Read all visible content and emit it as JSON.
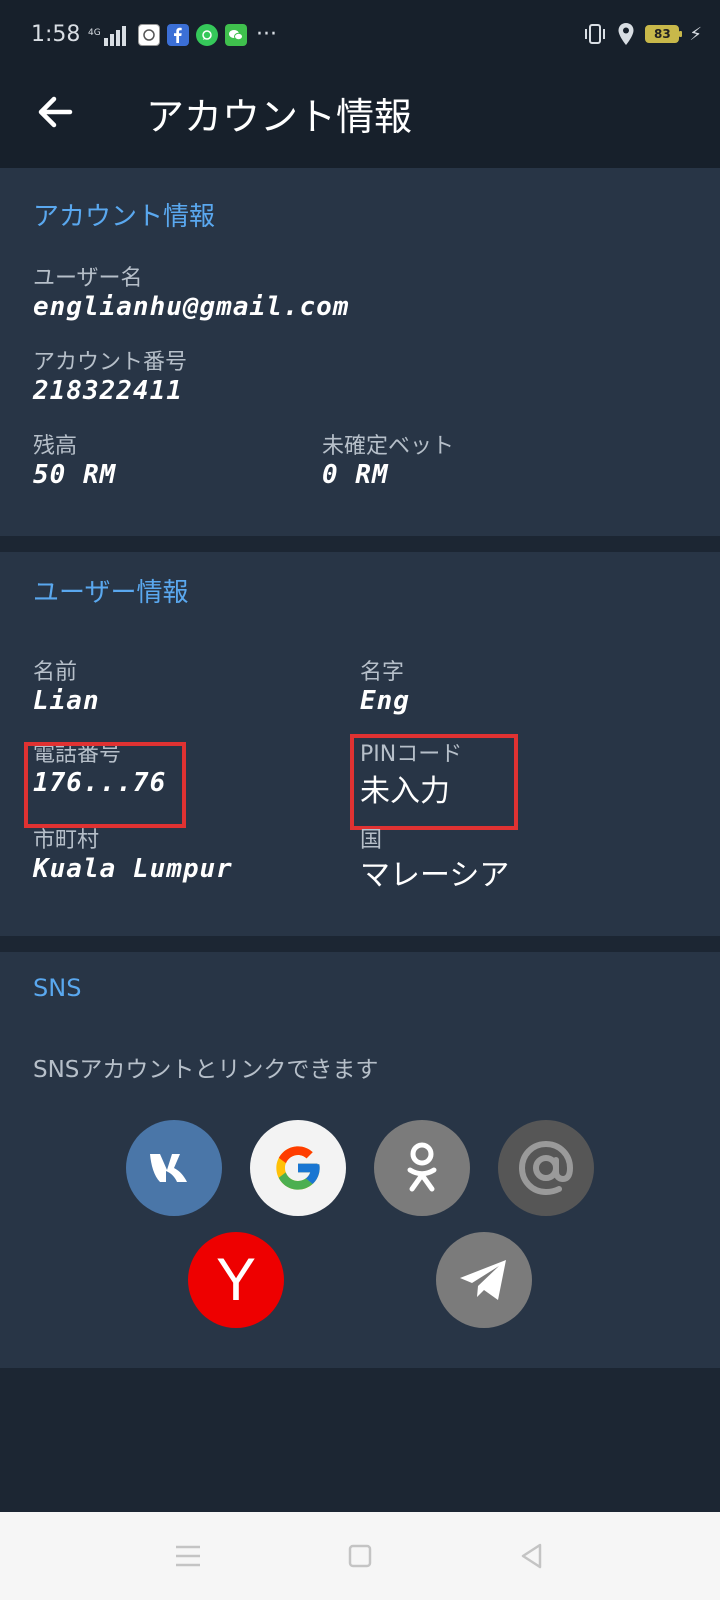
{
  "status_bar": {
    "time": "1:58",
    "network": "4G",
    "battery": "83"
  },
  "app_bar": {
    "title": "アカウント情報"
  },
  "account": {
    "section_title": "アカウント情報",
    "username_label": "ユーザー名",
    "username": "englianhu@gmail.com",
    "account_number_label": "アカウント番号",
    "account_number": "218322411",
    "balance_label": "残高",
    "balance": "50 RM",
    "pending_label": "未確定ベット",
    "pending": "0 RM"
  },
  "user": {
    "section_title": "ユーザー情報",
    "first_name_label": "名前",
    "first_name": "Lian",
    "last_name_label": "名字",
    "last_name": "Eng",
    "phone_label": "電話番号",
    "phone": "176...76",
    "pin_label": "PINコード",
    "pin": "未入力",
    "city_label": "市町村",
    "city": "Kuala Lumpur",
    "country_label": "国",
    "country": "マレーシア"
  },
  "sns": {
    "section_title": "SNS",
    "description": "SNSアカウントとリンクできます",
    "yandex_letter": "Y"
  },
  "colors": {
    "accent": "#5aa8ef",
    "highlight": "#e03232",
    "card": "#283546",
    "background": "#1c2633"
  }
}
